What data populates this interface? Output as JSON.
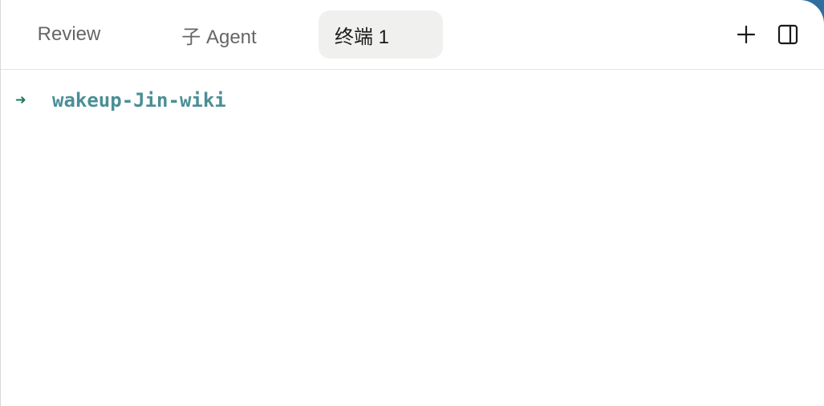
{
  "tabs": [
    {
      "label": "Review"
    },
    {
      "label": "子 Agent"
    },
    {
      "label": "终端 1",
      "active": true
    }
  ],
  "toolbar": {
    "add_icon": "plus-icon",
    "panel_icon": "split-panel-icon"
  },
  "terminal": {
    "prompt_symbol": "➜",
    "directory": "wakeup-Jin-wiki"
  },
  "colors": {
    "prompt_arrow": "#1f7a5a",
    "directory": "#4a8f96",
    "active_tab_bg": "#f0f0ef",
    "corner_accent": "#2f6f9f"
  }
}
